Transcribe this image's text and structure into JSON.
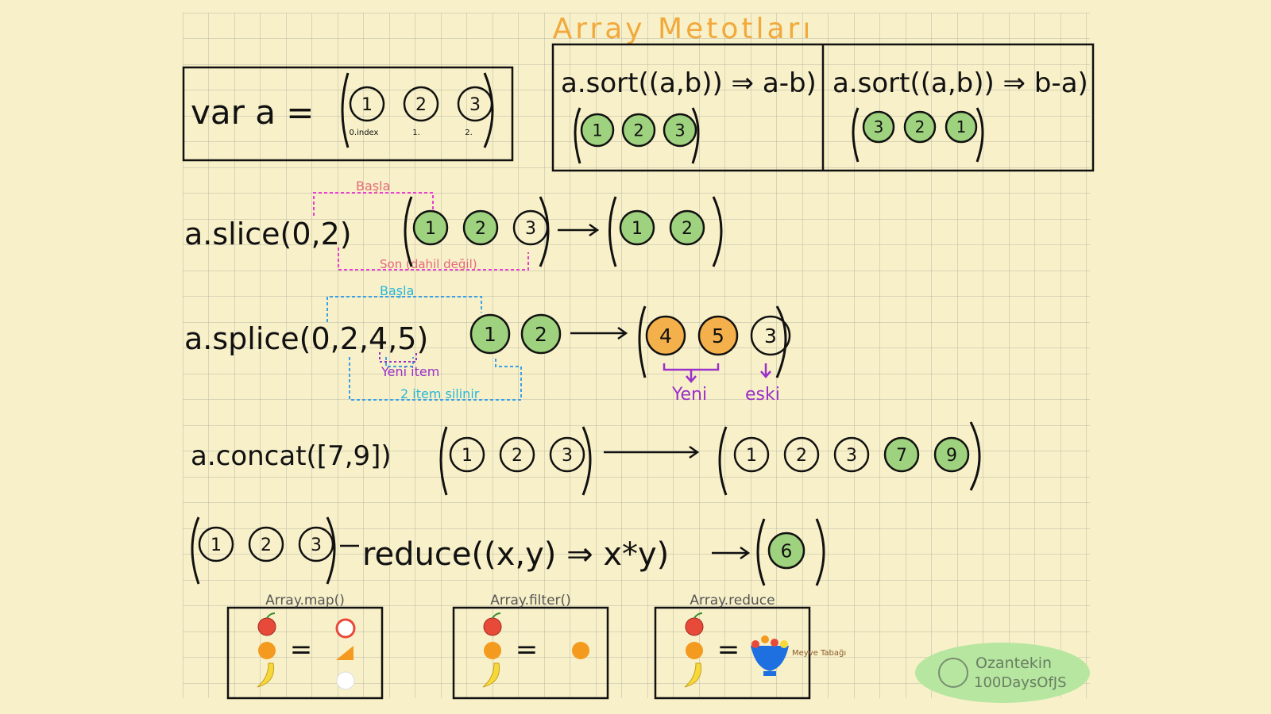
{
  "title": "Array Metotları",
  "var_decl": {
    "text": "var a =",
    "items": [
      "1",
      "2",
      "3"
    ],
    "index_labels": [
      "0.index",
      "1.",
      "2."
    ]
  },
  "sort_asc": {
    "code": "a.sort((a,b)) ⇒ a-b)",
    "result": [
      "1",
      "2",
      "3"
    ]
  },
  "sort_desc": {
    "code": "a.sort((a,b)) ⇒ b-a)",
    "result": [
      "3",
      "2",
      "1"
    ]
  },
  "slice": {
    "code": "a.slice(0,2)",
    "input": [
      "1",
      "2",
      "3"
    ],
    "output": [
      "1",
      "2"
    ],
    "start_label": "Başla",
    "end_label": "Son (dahil değil)"
  },
  "splice": {
    "code": "a.splice(0,2,4,5)",
    "removed": [
      "1",
      "2"
    ],
    "output": [
      "4",
      "5",
      "3"
    ],
    "start_label": "Başla",
    "removed_label": "2 item silinir",
    "new_items_label": "Yeni item",
    "new_label": "Yeni",
    "old_label": "eski"
  },
  "concat": {
    "code": "a.concat([7,9])",
    "input": [
      "1",
      "2",
      "3"
    ],
    "output": [
      "1",
      "2",
      "3",
      "7",
      "9"
    ]
  },
  "reduce": {
    "input": [
      "1",
      "2",
      "3"
    ],
    "code": "reduce((x,y) ⇒ x*y)",
    "output": [
      "6"
    ]
  },
  "panels": [
    {
      "title": "Array.map()",
      "result": "="
    },
    {
      "title": "Array.filter()",
      "result": "="
    },
    {
      "title": "Array.reduce",
      "result": "=",
      "bowl_label": "Meyve Tabağı"
    }
  ],
  "signature": {
    "name": "Ozantekin",
    "tag": "100DaysOfJS"
  },
  "colors": {
    "background": "#f8f0c8",
    "grid": "#b9b7a6",
    "title": "#f2a93b",
    "circle_green": "#9fd27e",
    "circle_orange": "#f4b04a",
    "slice_guide": "#e83fd0",
    "splice_guide": "#3aa0e8",
    "purple": "#9b2fc9",
    "signature_bg": "#b6e6a0"
  }
}
